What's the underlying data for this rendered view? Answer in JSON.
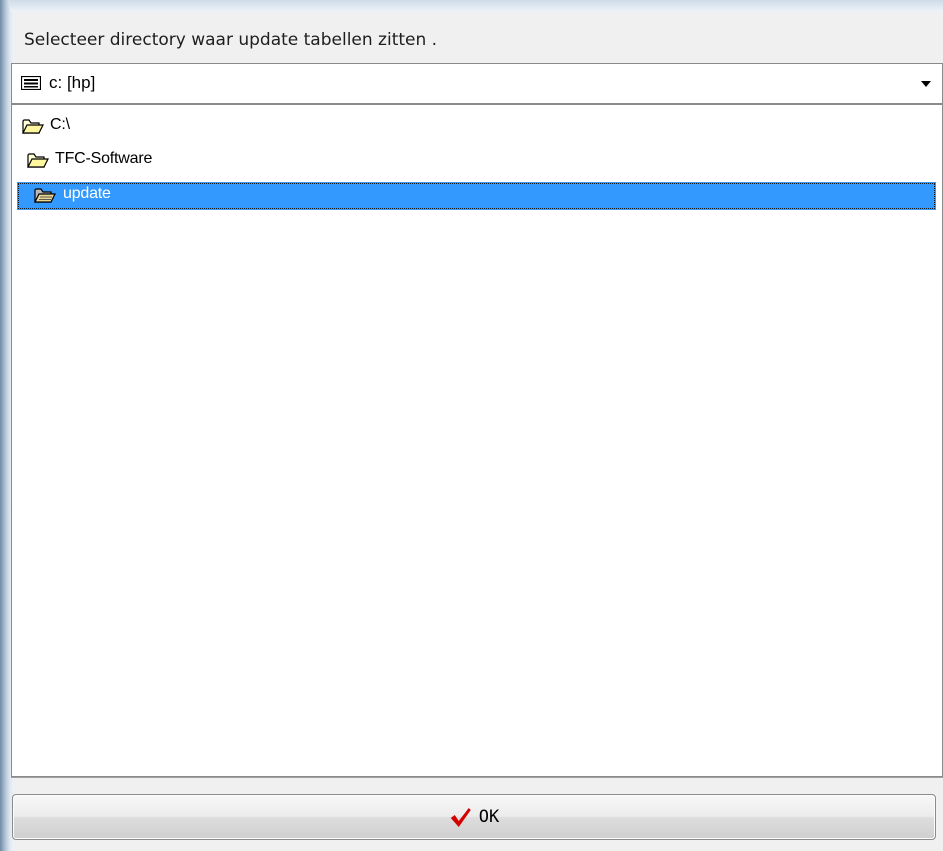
{
  "dialog": {
    "title": "Selecteer directory waar update tabellen zitten ."
  },
  "drive_select": {
    "value": "c: [hp]",
    "icon": "drive-icon"
  },
  "tree": {
    "items": [
      {
        "label": "C:\\",
        "icon": "open-folder-icon",
        "selected": false
      },
      {
        "label": "TFC-Software",
        "icon": "open-folder-icon",
        "selected": false
      },
      {
        "label": "update",
        "icon": "open-folder-icon",
        "selected": true
      }
    ],
    "selection_color": "#3399ff"
  },
  "ok_button": {
    "label": "OK",
    "icon": "checkmark-icon",
    "icon_color": "#d40000"
  }
}
